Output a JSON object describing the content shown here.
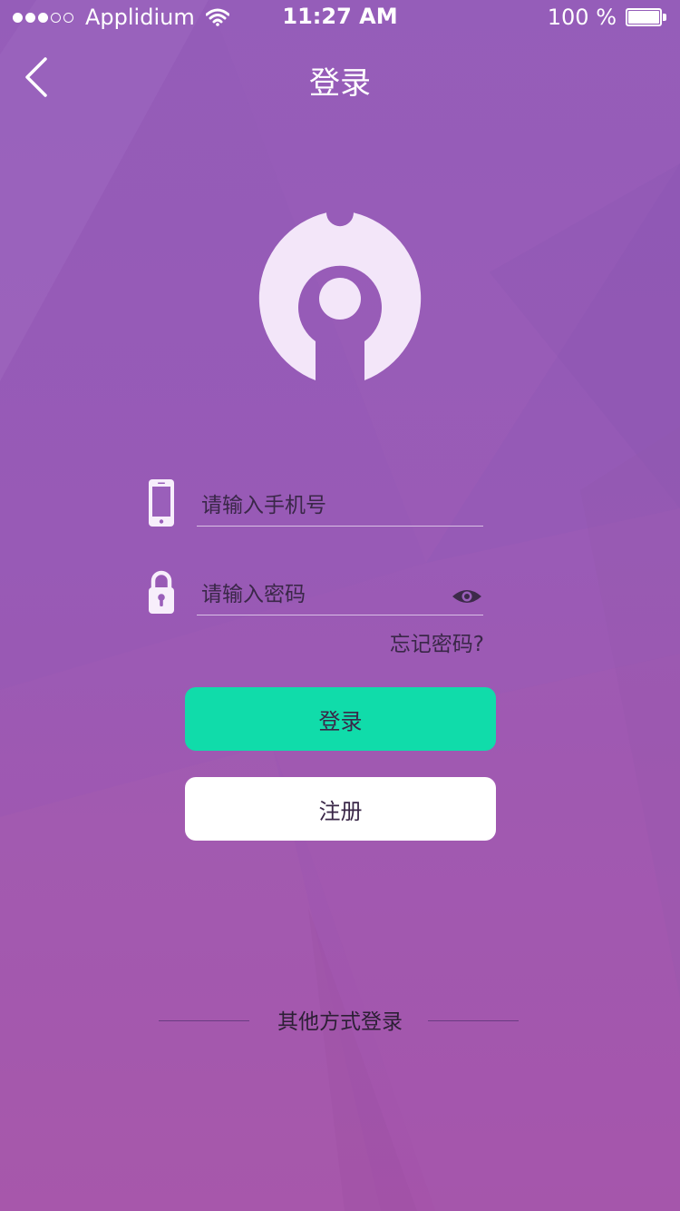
{
  "status_bar": {
    "carrier": "Applidium",
    "time": "11:27 AM",
    "battery": "100 %",
    "signal_dots": [
      true,
      true,
      true,
      false,
      false
    ],
    "icons": [
      "wifi-icon",
      "battery-icon"
    ]
  },
  "nav": {
    "back_icon": "chevron-left-icon",
    "title": "登录"
  },
  "logo": {
    "icon": "keyhole-logo-icon",
    "color": "#f3e6f9"
  },
  "form": {
    "phone": {
      "icon": "phone-icon",
      "placeholder": "请输入手机号",
      "value": ""
    },
    "password": {
      "icon": "lock-icon",
      "placeholder": "请输入密码",
      "value": "",
      "toggle_icon": "eye-icon"
    },
    "forgot_label": "忘记密码?"
  },
  "buttons": {
    "login_label": "登录",
    "register_label": "注册"
  },
  "other_login": {
    "label": "其他方式登录"
  },
  "colors": {
    "background_top": "#955db9",
    "background_bottom": "#a554aa",
    "login_button": "#10dcaa",
    "register_button": "#ffffff",
    "text_dark": "#3a2748"
  }
}
